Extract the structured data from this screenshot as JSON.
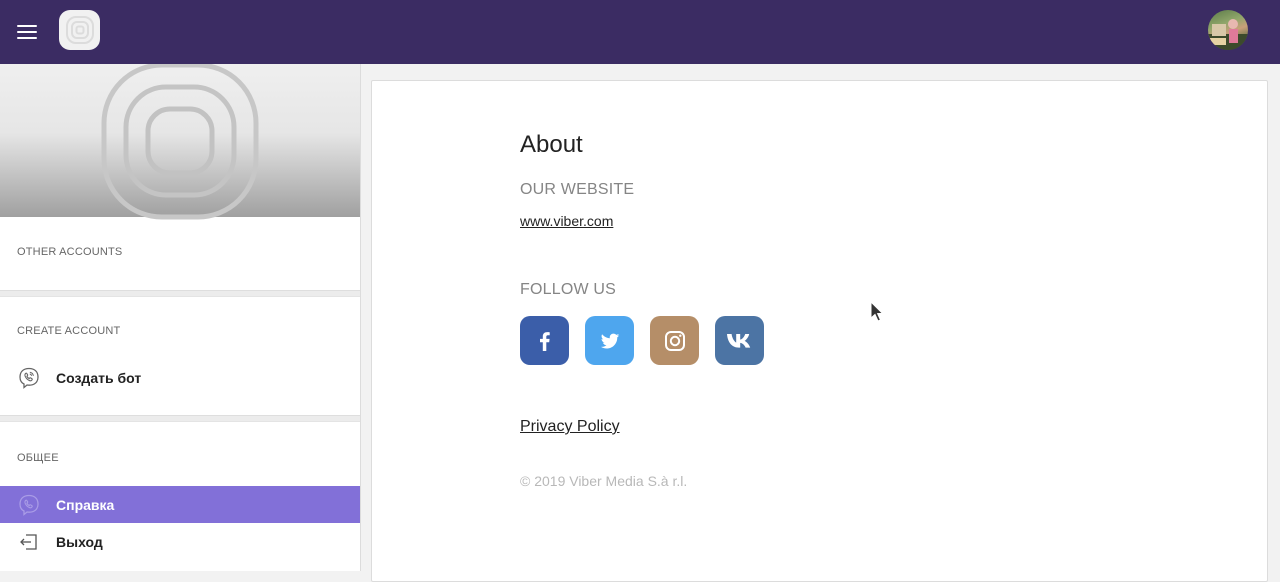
{
  "header": {
    "menu_icon": "hamburger-menu-icon",
    "logo_icon": "viber-logo-icon",
    "avatar_icon": "user-avatar"
  },
  "sidebar": {
    "other_accounts_label": "OTHER ACCOUNTS",
    "create_account_label": "CREATE ACCOUNT",
    "create_bot_label": "Создать бот",
    "general_label": "ОБЩЕЕ",
    "help_label": "Справка",
    "logout_label": "Выход",
    "active_color": "#8270d8"
  },
  "about": {
    "title": "About",
    "website_heading": "OUR WEBSITE",
    "website_link": "www.viber.com",
    "follow_heading": "FOLLOW US",
    "socials": [
      {
        "name": "facebook",
        "icon": "facebook-icon",
        "color": "#3b5ea9"
      },
      {
        "name": "twitter",
        "icon": "twitter-icon",
        "color": "#4ea6ee"
      },
      {
        "name": "instagram",
        "icon": "instagram-icon",
        "color": "#b58e68"
      },
      {
        "name": "vk",
        "icon": "vk-icon",
        "color": "#4c74a4"
      }
    ],
    "privacy_link": "Privacy Policy",
    "copyright": "© 2019 Viber Media S.à r.l."
  },
  "colors": {
    "topbar": "#3b2c63"
  }
}
